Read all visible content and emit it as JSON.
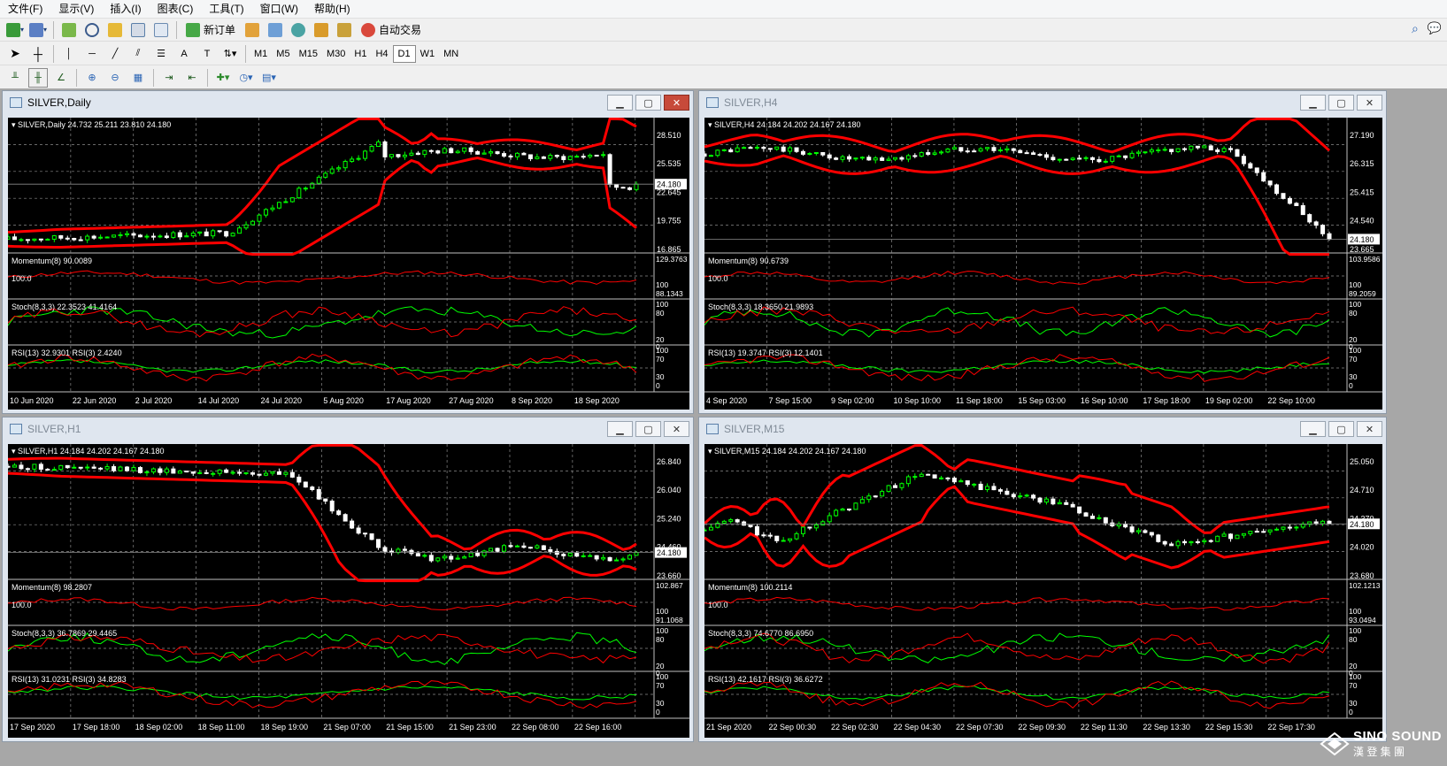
{
  "menu": [
    "文件(F)",
    "显示(V)",
    "插入(I)",
    "图表(C)",
    "工具(T)",
    "窗口(W)",
    "帮助(H)"
  ],
  "toolbar": {
    "new_order": "新订单",
    "auto_trade": "自动交易",
    "timeframes": [
      "M1",
      "M5",
      "M15",
      "M30",
      "H1",
      "H4",
      "D1",
      "W1",
      "MN"
    ],
    "active_timeframe": "D1"
  },
  "windows": [
    {
      "title": "SILVER,Daily",
      "active": true,
      "header": "SILVER,Daily  24.732 25.211 23.810 24.180",
      "price_ticks": [
        "28.510",
        "25.535",
        "22.645",
        "19.755",
        "16.865"
      ],
      "current_price": "24.180",
      "momentum_label": "Momentum(8) 90.0089",
      "momentum_extra": "100.0",
      "momentum_ticks": [
        "129.3763",
        "100",
        "88.1343"
      ],
      "stoch_label": "Stoch(8,3,3) 22.3523 41.4164",
      "stoch_ticks": [
        "100",
        "80",
        "20",
        "0"
      ],
      "rsi_label": "RSI(13) 32.9301  RSI(3) 2.4240",
      "rsi_ticks": [
        "100",
        "70",
        "30",
        "0"
      ],
      "dates": [
        "10 Jun 2020",
        "22 Jun 2020",
        "2 Jul 2020",
        "14 Jul 2020",
        "24 Jul 2020",
        "5 Aug 2020",
        "17 Aug 2020",
        "27 Aug 2020",
        "8 Sep 2020",
        "18 Sep 2020"
      ]
    },
    {
      "title": "SILVER,H4",
      "active": false,
      "header": "SILVER,H4  24.184 24.202 24.167 24.180",
      "price_ticks": [
        "27.190",
        "26.315",
        "25.415",
        "24.540",
        "23.665"
      ],
      "current_price": "24.180",
      "momentum_label": "Momentum(8) 90.6739",
      "momentum_extra": "100.0",
      "momentum_ticks": [
        "103.9586",
        "100",
        "89.2059"
      ],
      "stoch_label": "Stoch(8,3,3) 18.3650 21.9893",
      "stoch_ticks": [
        "100",
        "80",
        "20",
        "0"
      ],
      "rsi_label": "RSI(13) 19.3747  RSI(3) 12.1401",
      "rsi_ticks": [
        "100",
        "70",
        "30",
        "0"
      ],
      "dates": [
        "4 Sep 2020",
        "7 Sep 15:00",
        "9 Sep 02:00",
        "10 Sep 10:00",
        "11 Sep 18:00",
        "15 Sep 03:00",
        "16 Sep 10:00",
        "17 Sep 18:00",
        "19 Sep 02:00",
        "22 Sep 10:00"
      ]
    },
    {
      "title": "SILVER,H1",
      "active": false,
      "header": "SILVER,H1  24.184 24.202 24.167 24.180",
      "price_ticks": [
        "26.840",
        "26.040",
        "25.240",
        "24.460",
        "23.660"
      ],
      "current_price": "24.180",
      "momentum_label": "Momentum(8) 98.2807",
      "momentum_extra": "100.0",
      "momentum_ticks": [
        "102.867",
        "100",
        "91.1068"
      ],
      "stoch_label": "Stoch(8,3,3) 36.7869 29.4465",
      "stoch_ticks": [
        "100",
        "80",
        "20",
        "0"
      ],
      "rsi_label": "RSI(13) 31.0231  RSI(3) 34.8283",
      "rsi_ticks": [
        "100",
        "70",
        "30",
        "0"
      ],
      "dates": [
        "17 Sep 2020",
        "17 Sep 18:00",
        "18 Sep 02:00",
        "18 Sep 11:00",
        "18 Sep 19:00",
        "21 Sep 07:00",
        "21 Sep 15:00",
        "21 Sep 23:00",
        "22 Sep 08:00",
        "22 Sep 16:00"
      ]
    },
    {
      "title": "SILVER,M15",
      "active": false,
      "header": "SILVER,M15  24.184 24.202 24.167 24.180",
      "price_ticks": [
        "25.050",
        "24.710",
        "24.370",
        "24.020",
        "23.680"
      ],
      "current_price": "24.180",
      "momentum_label": "Momentum(8) 100.2114",
      "momentum_extra": "100.0",
      "momentum_ticks": [
        "102.1213",
        "100",
        "93.0494"
      ],
      "stoch_label": "Stoch(8,3,3) 74.6770 86.6950",
      "stoch_ticks": [
        "100",
        "80",
        "20",
        "0"
      ],
      "rsi_label": "RSI(13) 42.1617  RSI(3) 36.6272",
      "rsi_ticks": [
        "100",
        "70",
        "30",
        "0"
      ],
      "dates": [
        "21 Sep 2020",
        "22 Sep 00:30",
        "22 Sep 02:30",
        "22 Sep 04:30",
        "22 Sep 07:30",
        "22 Sep 09:30",
        "22 Sep 11:30",
        "22 Sep 13:30",
        "22 Sep 15:30",
        "22 Sep 17:30"
      ]
    }
  ],
  "watermark": {
    "brand": "SINO SOUND",
    "sub": "漢 登 集 團"
  },
  "colors": {
    "bullish": "#00ff00",
    "bearish": "#ffffff",
    "band": "#ff0000",
    "grid": "#c0c0c0",
    "chart_bg": "#000000"
  }
}
